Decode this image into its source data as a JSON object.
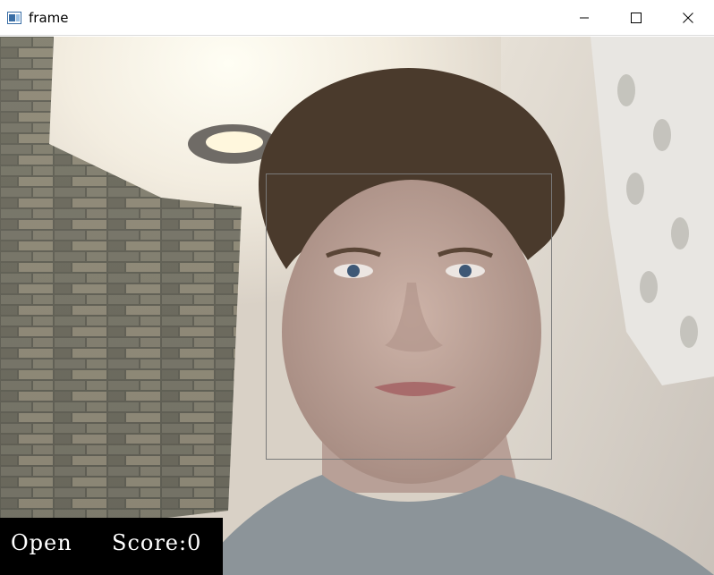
{
  "window": {
    "title": "frame",
    "icons": {
      "app": "window-app-icon",
      "minimize": "minimize-icon",
      "maximize": "maximize-icon",
      "close": "close-icon"
    }
  },
  "overlay": {
    "state_label": "Open",
    "score_label": "Score:0"
  },
  "colors": {
    "title_bg": "#ffffff",
    "overlay_bg": "#000000",
    "overlay_text": "#ffffff",
    "face_box": "#7a7a7a"
  }
}
